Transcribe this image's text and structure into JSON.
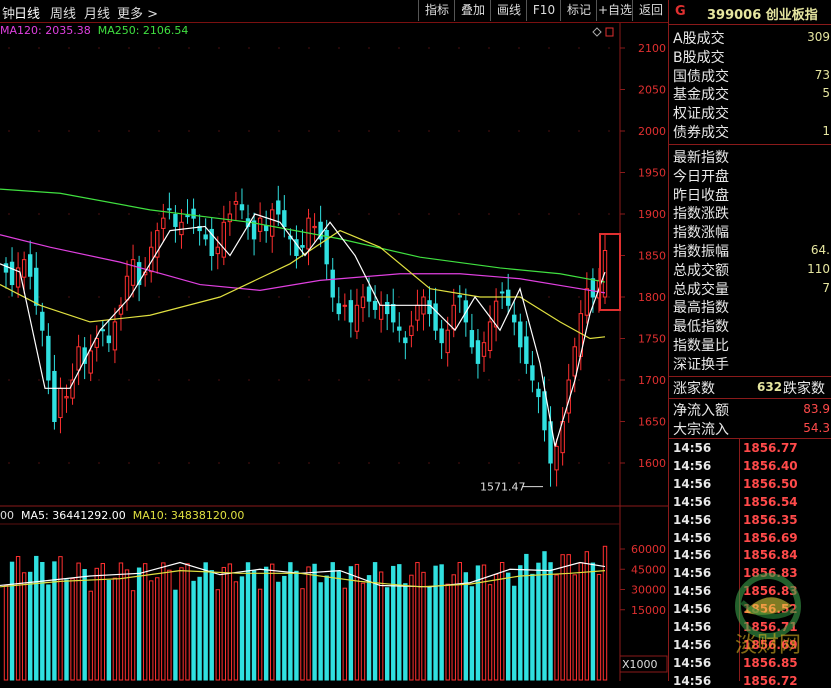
{
  "toolbar": {
    "tabs": [
      {
        "label": "钟",
        "active": false
      },
      {
        "label": "日线",
        "active": true
      },
      {
        "label": "周线",
        "active": false
      },
      {
        "label": "月线",
        "active": false
      },
      {
        "label": "更多 >",
        "active": false
      }
    ],
    "buttons": [
      "指标",
      "叠加",
      "画线",
      "F10",
      "标记",
      "+自选",
      "返回"
    ]
  },
  "ma_legend": [
    {
      "label": "MA120: 2035.38",
      "color": "#e040e0"
    },
    {
      "label": "MA250: 2106.54",
      "color": "#40e040"
    }
  ],
  "vol_legend": [
    {
      "label": "00",
      "color": "#dddddd"
    },
    {
      "label": "MA5: 36441292.00",
      "color": "#ffffff"
    },
    {
      "label": "MA10: 34838120.00",
      "color": "#e0e040"
    }
  ],
  "price_axis": [
    "2100",
    "2050",
    "2000",
    "1950",
    "1900",
    "1850",
    "1800",
    "1750",
    "1700",
    "1650",
    "1600"
  ],
  "volume_axis": [
    "60000",
    "45000",
    "30000",
    "15000"
  ],
  "volume_unit": "X1000",
  "low_marker": "1571.47",
  "colors": {
    "up": "#ff3030",
    "down": "#30e0e0",
    "panel_border": "#8a1a1a",
    "highlight_box": "#e03030"
  },
  "chart_data": {
    "type": "candlestick",
    "y_range": [
      1560,
      2130
    ],
    "ma_lines": [
      "MA5 (white)",
      "MA20 (yellow)",
      "MA120 (magenta)",
      "MA250 (green)"
    ],
    "lowest_annotated": 1571.47,
    "latest_close": 1856.85
  },
  "panel": {
    "header": {
      "code": "G",
      "title": "399006 创业板指"
    },
    "trade_rows": [
      {
        "label": "A股成交",
        "value": "309"
      },
      {
        "label": "B股成交",
        "value": ""
      },
      {
        "label": "国债成交",
        "value": "73"
      },
      {
        "label": "基金成交",
        "value": "5"
      },
      {
        "label": "权证成交",
        "value": ""
      },
      {
        "label": "债券成交",
        "value": "1"
      }
    ],
    "index_rows": [
      {
        "label": "最新指数",
        "value": ""
      },
      {
        "label": "今日开盘",
        "value": ""
      },
      {
        "label": "昨日收盘",
        "value": ""
      },
      {
        "label": "指数涨跌",
        "value": ""
      },
      {
        "label": "指数涨幅",
        "value": ""
      },
      {
        "label": "指数振幅",
        "value": "64."
      },
      {
        "label": "总成交额",
        "value": "110"
      },
      {
        "label": "总成交量",
        "value": "7"
      },
      {
        "label": "最高指数",
        "value": ""
      },
      {
        "label": "最低指数",
        "value": ""
      },
      {
        "label": "指数量比",
        "value": ""
      },
      {
        "label": "深证换手",
        "value": ""
      }
    ],
    "breadth": {
      "up_label": "涨家数",
      "up_value": "632",
      "down_label": "跌家数"
    },
    "flows": [
      {
        "label": "净流入额",
        "value": "83.9"
      },
      {
        "label": "大宗流入",
        "value": "54.3"
      }
    ],
    "ticks": [
      {
        "time": "14:56",
        "price": "1856.77"
      },
      {
        "time": "14:56",
        "price": "1856.40"
      },
      {
        "time": "14:56",
        "price": "1856.50"
      },
      {
        "time": "14:56",
        "price": "1856.54"
      },
      {
        "time": "14:56",
        "price": "1856.35"
      },
      {
        "time": "14:56",
        "price": "1856.69"
      },
      {
        "time": "14:56",
        "price": "1856.84"
      },
      {
        "time": "14:56",
        "price": "1856.83"
      },
      {
        "time": "14:56",
        "price": "1856.83"
      },
      {
        "time": "14:56",
        "price": "1856.52"
      },
      {
        "time": "14:56",
        "price": "1856.71"
      },
      {
        "time": "14:56",
        "price": "1856.69"
      },
      {
        "time": "14:56",
        "price": "1856.85"
      },
      {
        "time": "14:56",
        "price": "1856.72"
      }
    ]
  },
  "watermark": {
    "text": "淡财网"
  }
}
